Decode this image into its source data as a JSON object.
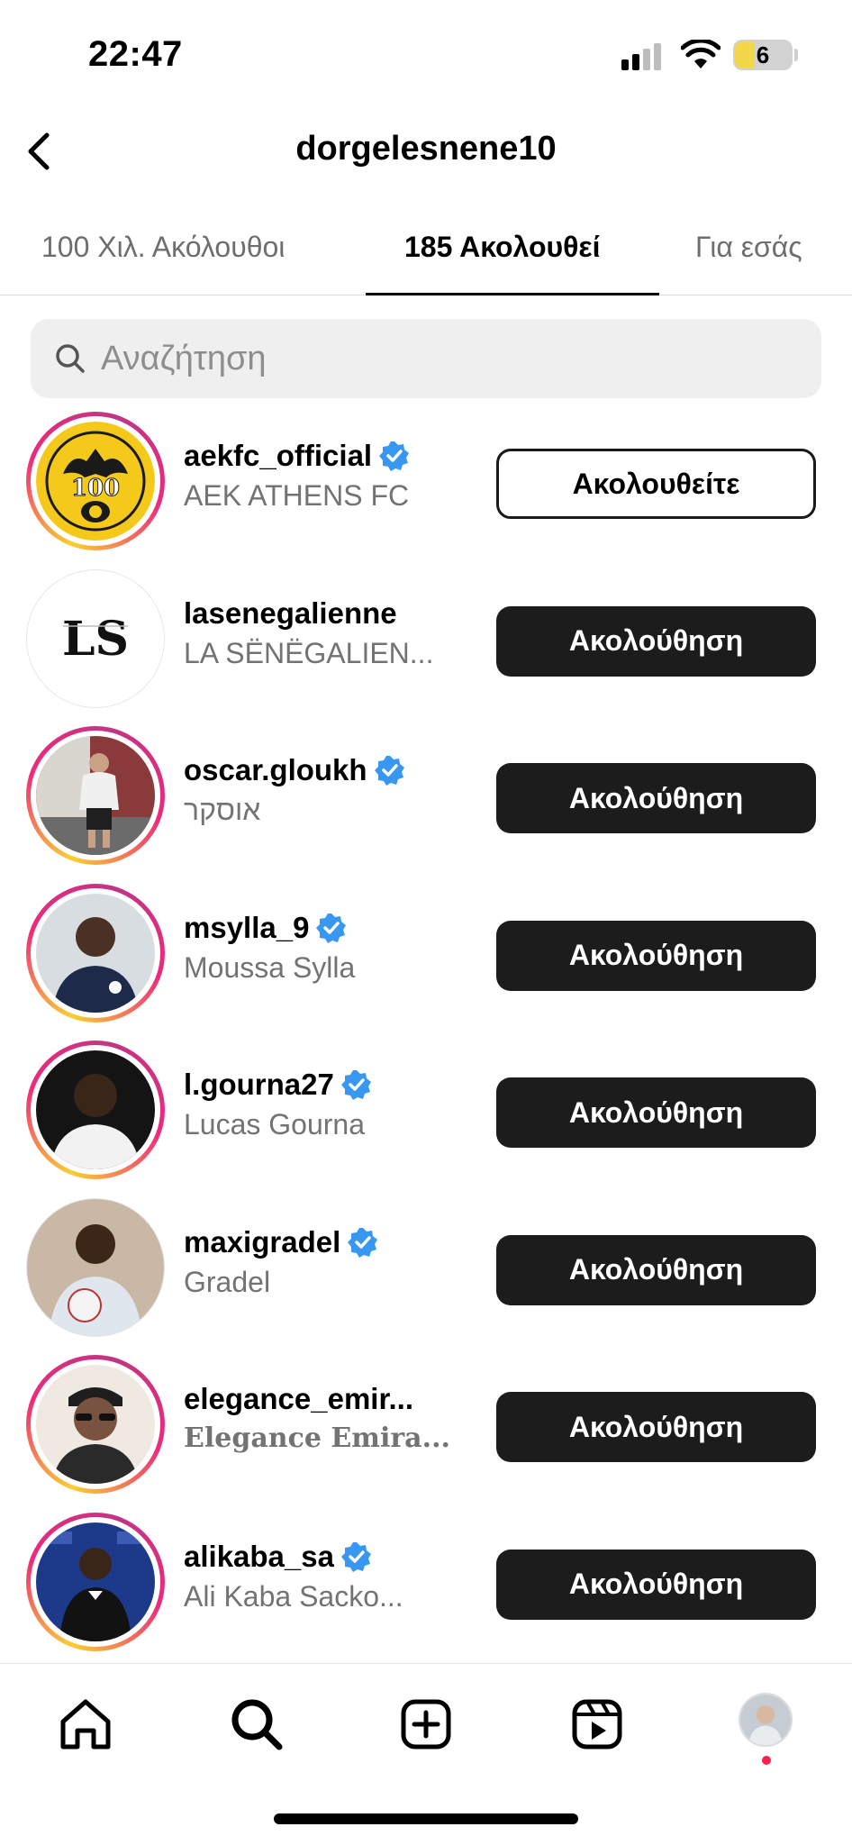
{
  "status_bar": {
    "time": "22:47",
    "battery": "6"
  },
  "header": {
    "title": "dorgelesnene10"
  },
  "tabs": [
    {
      "label": "100 Χιλ. Ακόλουθοι",
      "active": false
    },
    {
      "label": "185 Ακολουθεί",
      "active": true
    },
    {
      "label": "Για εσάς",
      "active": false
    }
  ],
  "search": {
    "placeholder": "Αναζήτηση"
  },
  "list": [
    {
      "username": "aekfc_official",
      "fullname": "AEK ATHENS FC",
      "verified": true,
      "button": "Ακολουθείτε",
      "button_style": "light",
      "avatar": "aek-crest",
      "story_ring": true
    },
    {
      "username": "lasenegalienne",
      "fullname": "LA SËNËGALIEN...",
      "verified": false,
      "button": "Ακολούθηση",
      "button_style": "dark",
      "avatar": "ls-logo",
      "story_ring": false
    },
    {
      "username": "oscar.gloukh",
      "fullname": "אוסקר",
      "verified": true,
      "button": "Ακολούθηση",
      "button_style": "dark",
      "avatar": "person-photo",
      "story_ring": true
    },
    {
      "username": "msylla_9",
      "fullname": "Moussa Sylla",
      "verified": true,
      "button": "Ακολούθηση",
      "button_style": "dark",
      "avatar": "person-photo",
      "story_ring": true
    },
    {
      "username": "l.gourna27",
      "fullname": "Lucas Gourna",
      "verified": true,
      "button": "Ακολούθηση",
      "button_style": "dark",
      "avatar": "person-photo",
      "story_ring": true
    },
    {
      "username": "maxigradel",
      "fullname": "Gradel",
      "verified": true,
      "button": "Ακολούθηση",
      "button_style": "dark",
      "avatar": "person-photo",
      "story_ring": false
    },
    {
      "username": "elegance_emir...",
      "fullname": "Elegance Emira...",
      "verified": false,
      "button": "Ακολούθηση",
      "button_style": "dark",
      "avatar": "person-photo",
      "story_ring": true
    },
    {
      "username": "alikaba_sa",
      "fullname": "Ali Kaba Sacko...",
      "verified": true,
      "button": "Ακολούθηση",
      "button_style": "dark",
      "avatar": "person-photo",
      "story_ring": true
    }
  ],
  "bottom_nav": [
    {
      "name": "home-icon"
    },
    {
      "name": "search-icon"
    },
    {
      "name": "create-icon"
    },
    {
      "name": "reels-icon"
    },
    {
      "name": "profile-avatar"
    }
  ],
  "colors": {
    "accent_verified": "#3897f0",
    "button_dark": "#1c1c1c",
    "notification_dot": "#ff1f4b"
  }
}
